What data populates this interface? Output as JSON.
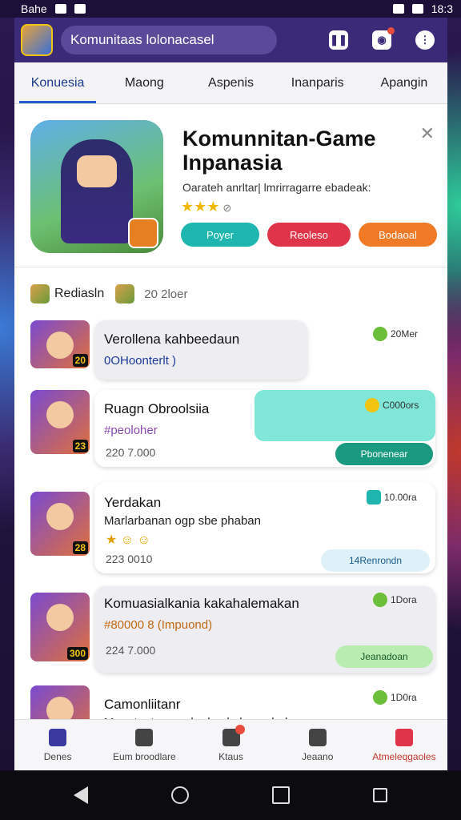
{
  "statusbar": {
    "left_text": "Bahe",
    "time": "18:3"
  },
  "topbar": {
    "search_text": "Komunitaas lolonacasel"
  },
  "tabs": [
    {
      "label": "Konuesia",
      "active": true
    },
    {
      "label": "Maong"
    },
    {
      "label": "Aspenis"
    },
    {
      "label": "Inanparis"
    },
    {
      "label": "Apangin"
    }
  ],
  "hero": {
    "title": "Komunnitan-Game Inpanasia",
    "description": "Oarateh anrltar| lmrirragarre ebadeak:",
    "stars": "★★★",
    "buttons": {
      "play": "Poyer",
      "review": "Reoleso",
      "share": "Bodaoal"
    }
  },
  "section": {
    "label": "Rediasln",
    "count": "20 2loer"
  },
  "feed": [
    {
      "title": "Verollena kahbeedaun",
      "sub": "0OHoonterlt )",
      "meta": "",
      "pill": "20Mer",
      "level": "20",
      "action": ""
    },
    {
      "title": "Ruagn Obroolsiia",
      "sub": "#peoloher",
      "meta": "220 7.000",
      "pill": "C000ors",
      "level": "23",
      "action": "Pbonenear"
    },
    {
      "title": "Yerdakan",
      "sub": "Marlarbanan ogp sbe phaban",
      "meta": "223 0010",
      "pill": "10.00ra",
      "level": "28",
      "action": "14Renrondn"
    },
    {
      "title": "Komuasialkania kakahalemakan",
      "sub": "#80000 8 (Impuond)",
      "meta": "224 7.000",
      "pill": "1Dora",
      "level": "300",
      "action": "Jeanadoan"
    },
    {
      "title": "Camonliitanr",
      "sub": "Manateatsamar ba kaokalan cabahsan",
      "meta": "",
      "pill": "1D0ra",
      "level": "",
      "action": ""
    }
  ],
  "bottomnav": [
    {
      "label": "Denes"
    },
    {
      "label": "Eum broodlare"
    },
    {
      "label": "Ktaus"
    },
    {
      "label": "Jeaano"
    },
    {
      "label": "Atmeleqgaoles"
    }
  ]
}
